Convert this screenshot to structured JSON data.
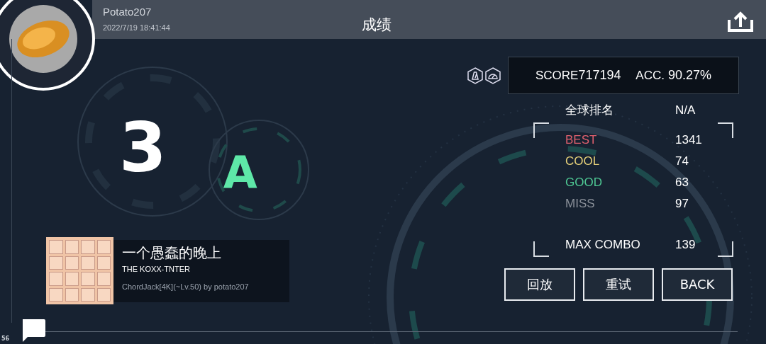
{
  "player": {
    "name": "Potato207",
    "time": "2022/7/19 18:41:44"
  },
  "title": "成绩",
  "rank": "3",
  "grade": {
    "letter": "A",
    "color": "#5ee8a8"
  },
  "song": {
    "title": "一个愚蠢的晚上",
    "artist": "THE KOXX-TNTER",
    "chart": "ChordJack[4K](~Lv.50) by potato207"
  },
  "score": {
    "label": "SCORE",
    "value": "717194",
    "acc_label": "ACC.",
    "acc_value": "90.27%"
  },
  "global_rank": {
    "label": "全球排名",
    "value": "N/A"
  },
  "judgements": [
    {
      "label": "BEST",
      "value": "1341",
      "color": "#e0606e"
    },
    {
      "label": "COOL",
      "value": "74",
      "color": "#e8d27a"
    },
    {
      "label": "GOOD",
      "value": "63",
      "color": "#4fc994"
    },
    {
      "label": "MISS",
      "value": "97",
      "color": "#8a9099"
    }
  ],
  "max_combo": {
    "label": "MAX COMBO",
    "value": "139"
  },
  "buttons": [
    "回放",
    "重试",
    "BACK"
  ],
  "fps": "56"
}
